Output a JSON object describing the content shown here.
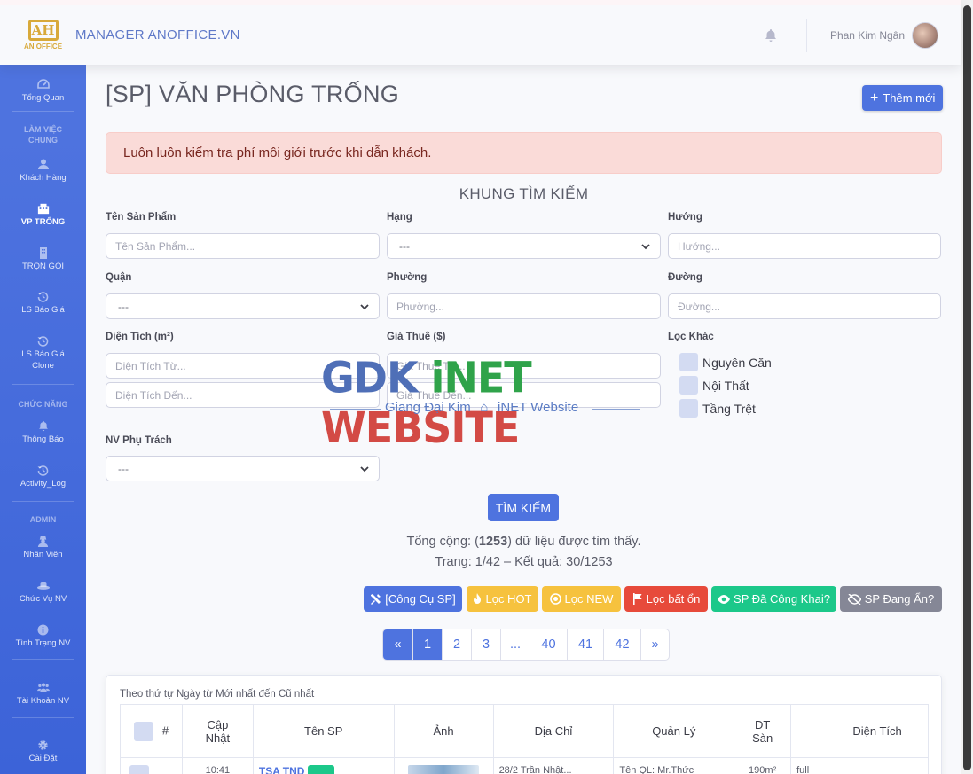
{
  "header": {
    "logo_mark": "AH",
    "logo_text": "AN OFFICE",
    "brand": "MANAGER ANOFFICE.VN",
    "user_name": "Phan Kim Ngân"
  },
  "sidebar": {
    "items": [
      {
        "label": "Tổng Quan",
        "icon": "dashboard-icon"
      },
      {
        "heading": "LÀM VIỆC CHUNG"
      },
      {
        "label": "Khách Hàng",
        "icon": "user-icon"
      },
      {
        "label": "VP TRỐNG",
        "icon": "building-icon",
        "active": true
      },
      {
        "label": "TRỌN GÓI",
        "icon": "building-icon"
      },
      {
        "label": "LS Báo Giá",
        "icon": "history-icon"
      },
      {
        "label": "LS Báo Giá Clone",
        "icon": "history-icon"
      },
      {
        "heading": "CHỨC NĂNG"
      },
      {
        "label": "Thông Báo",
        "icon": "bell-icon"
      },
      {
        "label": "Activity_Log",
        "icon": "history-icon"
      },
      {
        "heading": "ADMIN"
      },
      {
        "label": "Nhân Viên",
        "icon": "user-secret-icon"
      },
      {
        "label": "Chức Vụ NV",
        "icon": "hat-icon"
      },
      {
        "label": "Tình Trạng NV",
        "icon": "info-icon"
      },
      {
        "label": "Tài Khoản NV",
        "icon": "users-icon"
      },
      {
        "label": "Cài Đặt",
        "icon": "gear-icon"
      }
    ]
  },
  "page": {
    "title": "[SP] VĂN PHÒNG TRỐNG",
    "add_button": "Thêm mới",
    "alert": "Luôn luôn kiểm tra phí môi giới trước khi dẫn khách.",
    "search_title": "KHUNG TÌM KIẾM"
  },
  "filters": {
    "ten_sp": {
      "label": "Tên Sản Phẩm",
      "placeholder": "Tên Sản Phẩm..."
    },
    "hang": {
      "label": "Hạng",
      "value": "---"
    },
    "huong": {
      "label": "Hướng",
      "placeholder": "Hướng..."
    },
    "quan": {
      "label": "Quận",
      "value": "---"
    },
    "phuong": {
      "label": "Phường",
      "placeholder": "Phường..."
    },
    "duong": {
      "label": "Đường",
      "placeholder": "Đường..."
    },
    "dien_tich": {
      "label": "Diện Tích (m²)",
      "from_placeholder": "Diện Tích Từ...",
      "to_placeholder": "Diện Tích Đến..."
    },
    "gia_thue": {
      "label": "Giá Thuê ($)",
      "from_placeholder": "Giá Thuê Từ...",
      "to_placeholder": "Giá Thuê Đến..."
    },
    "loc_khac": {
      "label": "Lọc Khác",
      "options": [
        "Nguyên Căn",
        "Nội Thất",
        "Tầng Trệt"
      ]
    },
    "nv_phu_trach": {
      "label": "NV Phụ Trách",
      "value": "---"
    }
  },
  "search_button": "TÌM KIẾM",
  "summary": {
    "total_prefix": "Tổng cộng: (",
    "total": "1253",
    "total_suffix": ") dữ liệu được tìm thấy.",
    "page_line": "Trang: 1/42 – Kết quả: 30/1253"
  },
  "actions": [
    {
      "label": "[Công Cụ SP]",
      "icon": "tools-icon",
      "color": "#4e73df"
    },
    {
      "label": "Lọc HOT",
      "icon": "fire-icon",
      "color": "#f6c23e"
    },
    {
      "label": "Lọc NEW",
      "icon": "new-icon",
      "color": "#f6c23e"
    },
    {
      "label": "Lọc bất ổn",
      "icon": "flag-icon",
      "color": "#e74a3b"
    },
    {
      "label": "SP Đã Công Khai?",
      "icon": "eye-icon",
      "color": "#1cc88a"
    },
    {
      "label": "SP Đang Ẩn?",
      "icon": "eye-slash-icon",
      "color": "#858796"
    }
  ],
  "pagination": {
    "prev": "«",
    "pages": [
      "1",
      "2",
      "3",
      "...",
      "40",
      "41",
      "42"
    ],
    "next": "»",
    "current": "1"
  },
  "table": {
    "sort_note": "Theo thứ tự Ngày từ Mới nhất đến Cũ nhất",
    "headers": [
      "#",
      "Cập Nhật",
      "Tên SP",
      "Ảnh",
      "Địa Chỉ",
      "Quản Lý",
      "DT Sàn",
      "Diện Tích"
    ],
    "first_row": {
      "time": "10:41",
      "name": "TSA TND",
      "address": "28/2 Trần Nhật...",
      "manager": "Tên QL: Mr.Thức",
      "dt_san": "190m²",
      "dien_tich": "full"
    }
  },
  "watermark": {
    "gdk": "GDK",
    "inet": "iNET",
    "website": "WEBSITE",
    "tagline_1": "Giang Đại Kim",
    "tagline_2": "iNET Website"
  }
}
